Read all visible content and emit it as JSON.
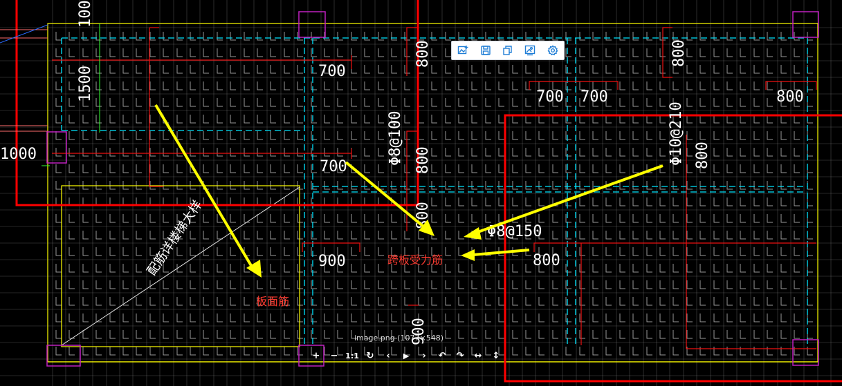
{
  "drawing": {
    "dims": {
      "d100": "100",
      "d1500": "1500",
      "d1000": "1000",
      "d700a": "700",
      "d800a": "800",
      "d700b": "700",
      "d700c": "700",
      "d800b": "800",
      "d700d": "700",
      "d800c": "800",
      "d800d": "800",
      "d800e": "800",
      "d900": "900",
      "d800f": "800",
      "d800g": "800",
      "d900b": "900"
    },
    "rebar": {
      "r1": "Φ8@100",
      "r2": "Φ10@210",
      "r3": "Φ8@150"
    },
    "stair_note": "配筋详楼梯大样",
    "labels": {
      "top_bar": "板面筋",
      "span_bar": "跨板受力筋"
    }
  },
  "toolbar": {
    "items": [
      {
        "name": "add-image-icon"
      },
      {
        "name": "save-icon"
      },
      {
        "name": "copy-icon"
      },
      {
        "name": "image-edit-icon"
      },
      {
        "name": "settings-icon"
      }
    ]
  },
  "viewer": {
    "caption": "image.png (1077×548)",
    "controls": [
      "+",
      "−",
      "1:1",
      "↻",
      "‹",
      "▶",
      "›",
      "↶",
      "↷",
      "↔",
      "↕"
    ]
  },
  "colors": {
    "background": "#000000",
    "grid": "#8a8a8a",
    "outline": "#ffff00",
    "dashed": "#00ffff",
    "rebar_red": "#ff0000",
    "column": "#c000c0",
    "arrow": "#ffff00",
    "toolbar_icon": "#1f7ed6"
  }
}
